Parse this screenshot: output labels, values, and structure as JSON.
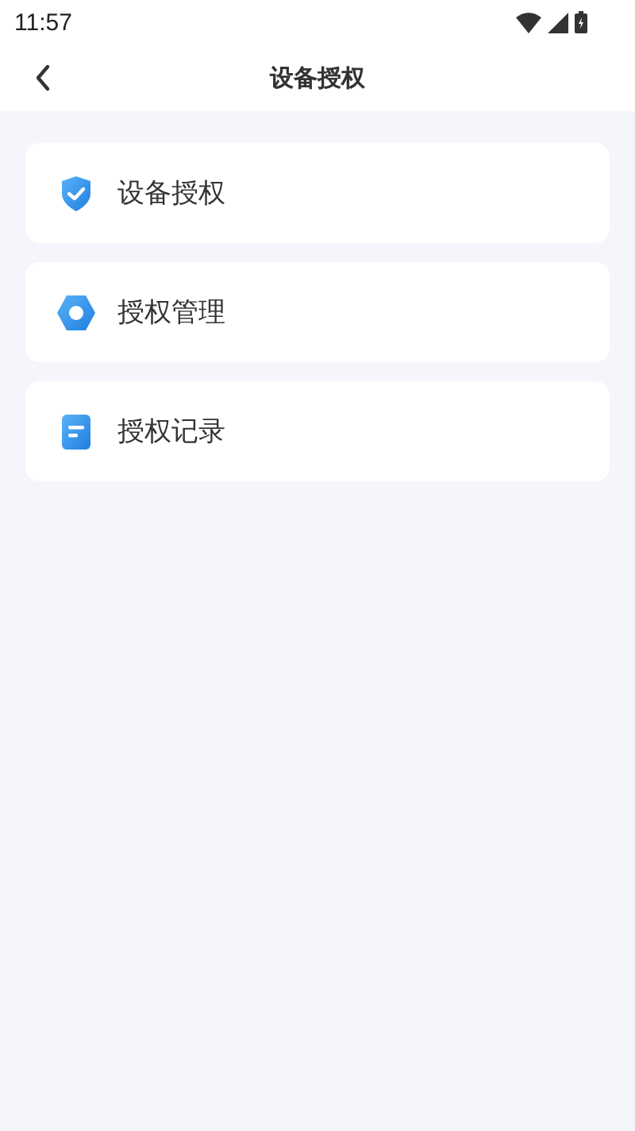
{
  "status_bar": {
    "time": "11:57"
  },
  "header": {
    "title": "设备授权"
  },
  "menu": [
    {
      "kind": "shield",
      "label": "设备授权"
    },
    {
      "kind": "hexagon",
      "label": "授权管理"
    },
    {
      "kind": "document",
      "label": "授权记录"
    }
  ]
}
